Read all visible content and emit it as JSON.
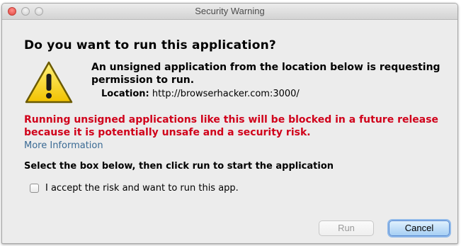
{
  "window": {
    "title": "Security Warning"
  },
  "dialog": {
    "heading": "Do you want to run this application?",
    "message": "An unsigned application from the location below is requesting permission to run.",
    "location_label": "Location:",
    "location_value": "http://browserhacker.com:3000/",
    "red_warning": "Running unsigned applications like this will be blocked in a future release because it is potentially unsafe and a security risk.",
    "more_info_link": "More Information",
    "instruction": "Select the box below, then click run to start the application",
    "accept_label": "I accept the risk and want to run this app.",
    "accept_checked": false
  },
  "buttons": {
    "run_label": "Run",
    "run_enabled": false,
    "cancel_label": "Cancel"
  },
  "icons": {
    "warning": "warning-triangle-icon",
    "close": "close-window-icon",
    "minimize": "minimize-window-icon",
    "zoom": "zoom-window-icon"
  },
  "colors": {
    "warning_text": "#d0021b",
    "link": "#3a6a94",
    "default_button": "#a6cff4"
  }
}
